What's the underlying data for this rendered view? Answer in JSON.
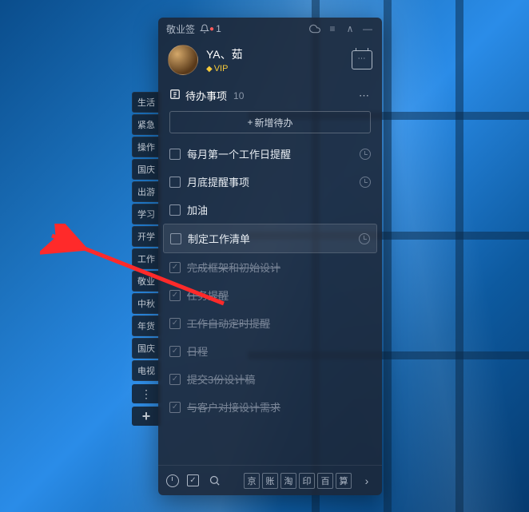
{
  "titlebar": {
    "app_name": "敬业签",
    "notif_count": "1"
  },
  "profile": {
    "username": "YA、茹",
    "vip_label": "VIP"
  },
  "section": {
    "title": "待办事项",
    "count": "10"
  },
  "add_button": {
    "label": "新增待办"
  },
  "todos": [
    {
      "label": "每月第一个工作日提醒",
      "done": false,
      "has_clock": true,
      "selected": false
    },
    {
      "label": "月底提醒事项",
      "done": false,
      "has_clock": true,
      "selected": false
    },
    {
      "label": "加油",
      "done": false,
      "has_clock": false,
      "selected": false
    },
    {
      "label": "制定工作清单",
      "done": false,
      "has_clock": true,
      "selected": true
    },
    {
      "label": "完成框架和初始设计",
      "done": true,
      "has_clock": false,
      "selected": false
    },
    {
      "label": "任务提醒",
      "done": true,
      "has_clock": false,
      "selected": false
    },
    {
      "label": "工作自动定时提醒",
      "done": true,
      "has_clock": false,
      "selected": false
    },
    {
      "label": "日程",
      "done": true,
      "has_clock": false,
      "selected": false
    },
    {
      "label": "提交3份设计稿",
      "done": true,
      "has_clock": false,
      "selected": false
    },
    {
      "label": "与客户对接设计需求",
      "done": true,
      "has_clock": false,
      "selected": false
    }
  ],
  "side_tabs": [
    "生活",
    "紧急",
    "操作",
    "国庆",
    "出游",
    "学习",
    "开学",
    "工作",
    "敬业",
    "中秋",
    "年货",
    "国庆",
    "电视"
  ],
  "bottom_squares": [
    "京",
    "账",
    "淘",
    "印",
    "百",
    "算"
  ]
}
